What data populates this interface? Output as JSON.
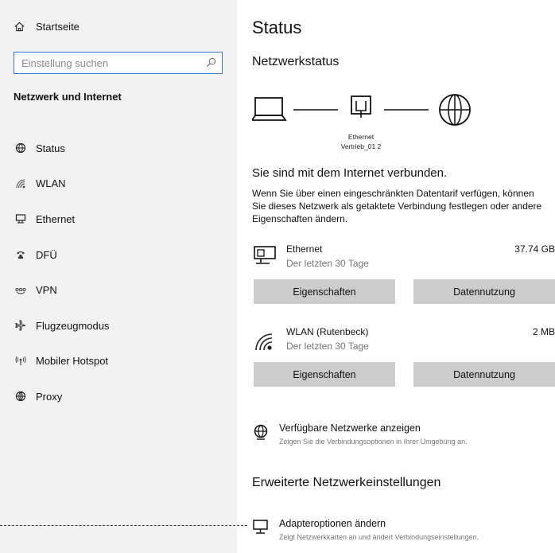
{
  "sidebar": {
    "home_label": "Startseite",
    "search_placeholder": "Einstellung suchen",
    "section_title": "Netzwerk und Internet",
    "items": [
      {
        "label": "Status",
        "icon": "globe-status-icon"
      },
      {
        "label": "WLAN",
        "icon": "wifi-icon"
      },
      {
        "label": "Ethernet",
        "icon": "ethernet-icon"
      },
      {
        "label": "DFÜ",
        "icon": "phone-icon"
      },
      {
        "label": "VPN",
        "icon": "vpn-icon"
      },
      {
        "label": "Flugzeugmodus",
        "icon": "airplane-icon"
      },
      {
        "label": "Mobiler Hotspot",
        "icon": "hotspot-icon"
      },
      {
        "label": "Proxy",
        "icon": "globe-icon"
      }
    ]
  },
  "main": {
    "title": "Status",
    "network_status_title": "Netzwerkstatus",
    "diagram": {
      "adapter_label_1": "Ethernet",
      "adapter_label_2": "Vertrieb_01 2"
    },
    "connected_message": "Sie sind mit dem Internet verbunden.",
    "info_text": "Wenn Sie über einen eingeschränkten Datentarif verfügen, können Sie dieses Netzwerk als getaktete Verbindung festlegen oder andere Eigenschaften ändern.",
    "connections": [
      {
        "name": "Ethernet",
        "sub": "Der letzten 30 Tage",
        "amount": "37.74 GB",
        "properties_label": "Eigenschaften",
        "usage_label": "Datennutzung"
      },
      {
        "name": "WLAN (Rutenbeck)",
        "sub": "Der letzten 30 Tage",
        "amount": "2 MB",
        "properties_label": "Eigenschaften",
        "usage_label": "Datennutzung"
      }
    ],
    "available_networks": {
      "title": "Verfügbare Netzwerke anzeigen",
      "sub": "Zeigen Sie die Verbindungsoptionen in Ihrer Umgebung an."
    },
    "advanced_title": "Erweiterte Netzwerkeinstellungen",
    "adapter_options": {
      "title": "Adapteroptionen ändern",
      "sub": "Zeigt Netzwerkkarten an und ändert Verbindungseinstellungen."
    }
  }
}
